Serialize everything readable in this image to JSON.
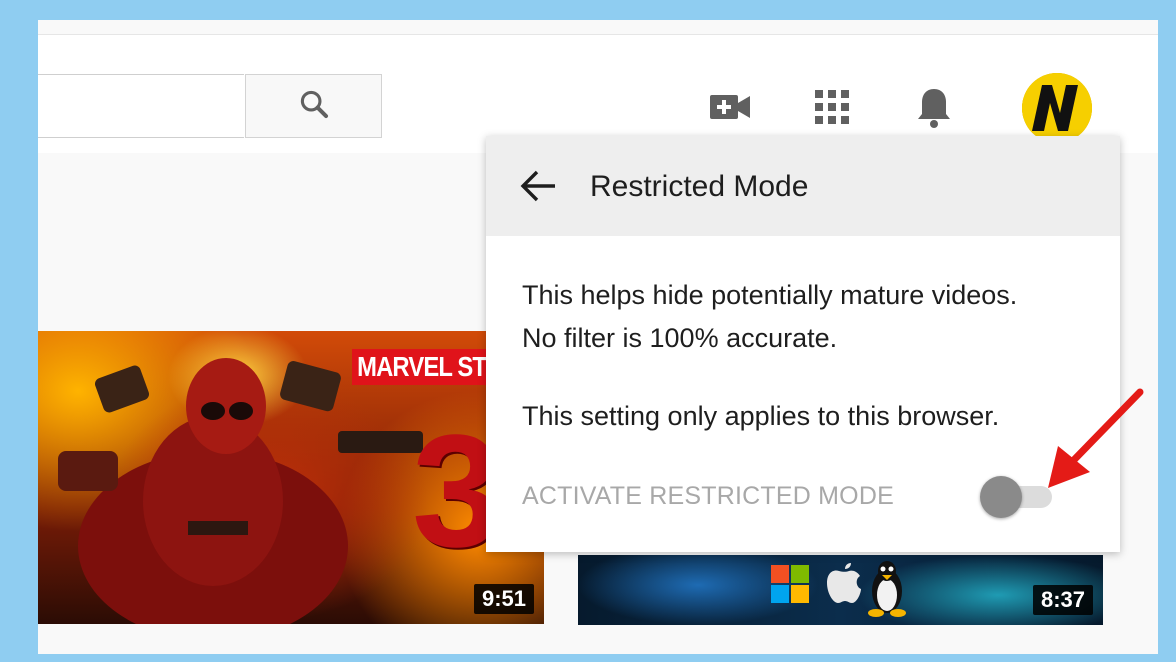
{
  "search": {
    "value": "",
    "placeholder": ""
  },
  "header_icons": [
    "search-icon",
    "create-video-icon",
    "apps-grid-icon",
    "notifications-bell-icon"
  ],
  "videos": [
    {
      "duration": "9:51",
      "overlay_text": "MARVEL STU",
      "overlay_number": "3"
    },
    {
      "duration": "8:37"
    }
  ],
  "restricted_panel": {
    "title": "Restricted Mode",
    "description_line1": "This helps hide potentially mature videos.",
    "description_line2": "No filter is 100% accurate.",
    "browser_note": "This setting only applies to this browser.",
    "toggle_label": "ACTIVATE RESTRICTED MODE",
    "toggle_on": false
  },
  "colors": {
    "frame_border": "#8fcdf1",
    "annotation_arrow": "#e41b17",
    "avatar_yellow": "#f6cf00"
  }
}
